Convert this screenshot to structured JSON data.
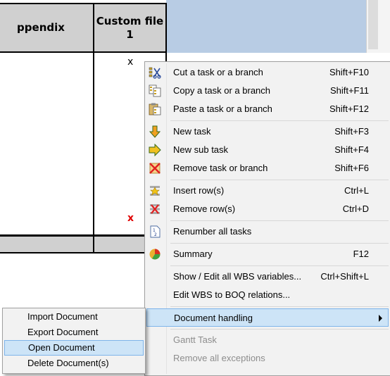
{
  "table": {
    "header_partial": "ppendix",
    "header_custom": "Custom file\n1",
    "cell_value": "x",
    "red_mark": "x"
  },
  "colors": {
    "header_bg": "#d0d0d0",
    "blue_area": "#b8cce4",
    "menu_bg": "#f2f2f2",
    "highlight": "#cde4f7",
    "red_mark": "#e00000"
  },
  "context_menu": {
    "items": [
      {
        "label": "Cut a task or a branch",
        "shortcut": "Shift+F10",
        "icon": "cut-icon"
      },
      {
        "label": "Copy a task or a branch",
        "shortcut": "Shift+F11",
        "icon": "copy-icon"
      },
      {
        "label": "Paste a task or a branch",
        "shortcut": "Shift+F12",
        "icon": "paste-icon"
      },
      {
        "label": "New task",
        "shortcut": "Shift+F3",
        "icon": "down-arrow-icon"
      },
      {
        "label": "New sub task",
        "shortcut": "Shift+F4",
        "icon": "right-arrow-icon"
      },
      {
        "label": "Remove task or branch",
        "shortcut": "Shift+F6",
        "icon": "remove-icon"
      },
      {
        "label": "Insert row(s)",
        "shortcut": "Ctrl+L",
        "icon": "insert-row-icon"
      },
      {
        "label": "Remove row(s)",
        "shortcut": "Ctrl+D",
        "icon": "remove-row-icon"
      },
      {
        "label": "Renumber all tasks",
        "shortcut": "",
        "icon": "renumber-icon"
      },
      {
        "label": "Summary",
        "shortcut": "F12",
        "icon": "summary-icon"
      },
      {
        "label": "Show / Edit all WBS variables...",
        "shortcut": "Ctrl+Shift+L",
        "icon": ""
      },
      {
        "label": "Edit WBS to BOQ relations...",
        "shortcut": "",
        "icon": ""
      },
      {
        "label": "Document handling",
        "shortcut": "",
        "icon": "submenu-arrow-icon"
      },
      {
        "label": "Gantt Task",
        "shortcut": "",
        "icon": ""
      },
      {
        "label": "Remove all exceptions",
        "shortcut": "",
        "icon": ""
      }
    ]
  },
  "doc_submenu": {
    "items": [
      {
        "label": "Import Document"
      },
      {
        "label": "Export Document"
      },
      {
        "label": "Open Document"
      },
      {
        "label": "Delete Document(s)"
      }
    ]
  }
}
